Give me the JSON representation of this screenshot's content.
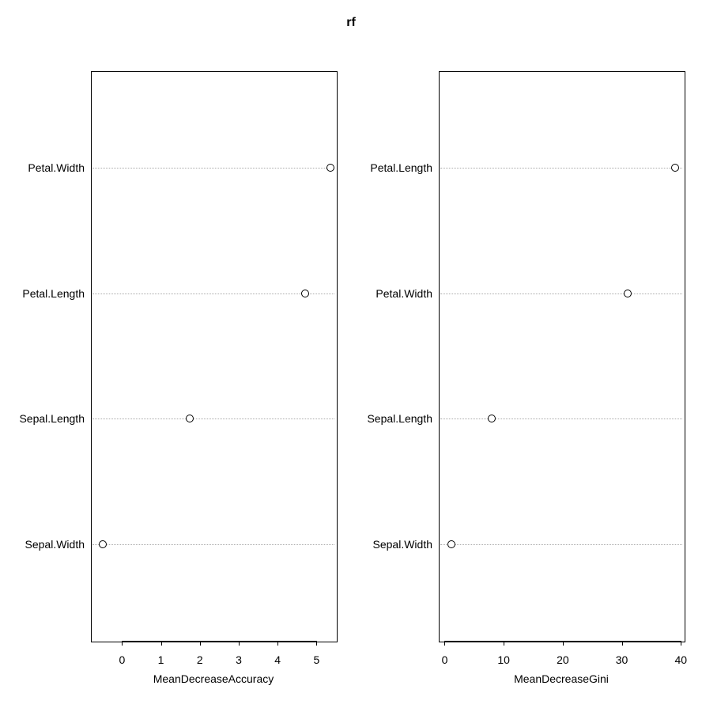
{
  "title": "rf",
  "chart_data": [
    {
      "type": "dot",
      "xlabel": "MeanDecreaseAccuracy",
      "categories": [
        "Petal.Width",
        "Petal.Length",
        "Sepal.Length",
        "Sepal.Width"
      ],
      "values": [
        5.35,
        4.7,
        1.75,
        -0.5
      ],
      "xlim": [
        -0.8,
        5.5
      ],
      "xticks": [
        0,
        1,
        2,
        3,
        4,
        5
      ]
    },
    {
      "type": "dot",
      "xlabel": "MeanDecreaseGini",
      "categories": [
        "Petal.Length",
        "Petal.Width",
        "Sepal.Length",
        "Sepal.Width"
      ],
      "values": [
        39,
        31,
        8,
        1.2
      ],
      "xlim": [
        -1,
        40.5
      ],
      "xticks": [
        0,
        10,
        20,
        30,
        40
      ]
    }
  ]
}
